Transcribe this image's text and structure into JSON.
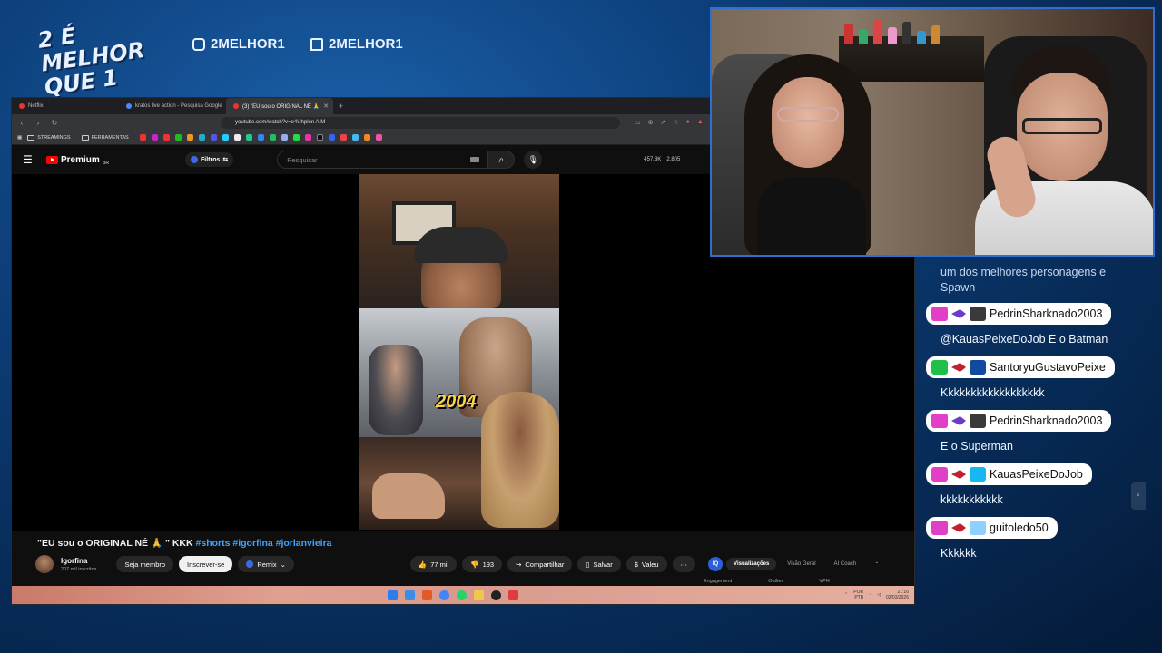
{
  "overlay": {
    "logo_text": "2 É MELHOR QUE 1",
    "instagram": "2MELHOR1",
    "twitch": "2MELHOR1"
  },
  "browser": {
    "tabs": [
      {
        "title": "Netflix",
        "active": false
      },
      {
        "title": "kratos live action - Pesquisa Google",
        "active": false
      },
      {
        "title": "(3) \"EU sou o ORIGINAL NÉ 🙏",
        "active": true
      }
    ],
    "url": "youtube.com/watch?v=o4Uhplen AIM",
    "bookmarks": [
      "STREAMINGS",
      "FERRAMENTAS"
    ]
  },
  "youtube": {
    "logo": "Premium",
    "region": "BR",
    "filters": "Filtros",
    "search_placeholder": "Pesquisar",
    "stats": [
      "457.8K",
      "2,805"
    ],
    "video_overlay_year": "2004",
    "video_title": "\"EU sou o ORIGINAL NÉ 🙏 \" KKK",
    "video_tags": "#shorts #igorfina #jorlanvieira",
    "channel": {
      "name": "Igorfina",
      "subs": "207 mil inscritos"
    },
    "buttons": {
      "join": "Seja membro",
      "subscribe": "Inscrever-se",
      "remix": "Remix",
      "likes": "77 mil",
      "dislikes": "193",
      "share": "Compartilhar",
      "save": "Salvar",
      "thanks": "Valeu",
      "more": "⋯"
    },
    "insights": {
      "badge": "IQ",
      "tabs": [
        "Visualizações",
        "Visão Geral",
        "AI Coach"
      ],
      "metrics": [
        "Engagement",
        "Outlier",
        "VPH"
      ]
    }
  },
  "taskbar": {
    "lang": "POR",
    "layout": "PTB",
    "time": "21:16",
    "date": "02/03/2026"
  },
  "chat": {
    "first_message": "um dos melhores personagens e Spawn",
    "messages": [
      {
        "user": "PedrinSharknado2003",
        "text": "@KauasPeixeDoJob E o Batman",
        "badges": [
          "b-pink",
          "b-purple",
          "b-dark"
        ]
      },
      {
        "user": "SantoryuGustavoPeixe",
        "text": "Kkkkkkkkkkkkkkkkkk",
        "badges": [
          "b-green",
          "b-red",
          "b-blue"
        ]
      },
      {
        "user": "PedrinSharknado2003",
        "text": "E o Superman",
        "badges": [
          "b-pink",
          "b-purple",
          "b-dark"
        ]
      },
      {
        "user": "KauasPeixeDoJob",
        "text": "kkkkkkkkkkk",
        "badges": [
          "b-pink",
          "b-red",
          "b-sky"
        ]
      },
      {
        "user": "guitoledo50",
        "text": "Kkkkkk",
        "badges": [
          "b-pink",
          "b-red",
          "b-light"
        ]
      }
    ]
  }
}
